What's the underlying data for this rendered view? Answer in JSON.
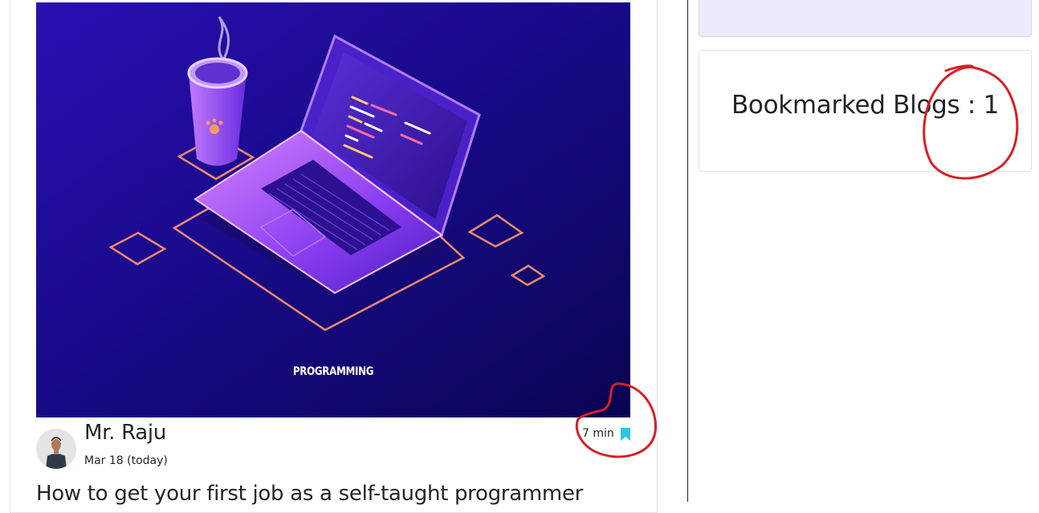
{
  "blog": {
    "cover_caption": "PROGRAMMING",
    "author": "Mr. Raju",
    "date": "Mar 18 (today)",
    "read_time": "7 min",
    "title": "How to get your first job as a self-taught programmer",
    "bookmark_icon": "bookmark-icon"
  },
  "sidebar": {
    "bookmarked_label": "Bookmarked Blogs : ",
    "bookmarked_count": "1"
  },
  "colors": {
    "bookmark": "#2ec4e6",
    "annotation": "#d81f26",
    "cover_bg": "#0f0660"
  }
}
